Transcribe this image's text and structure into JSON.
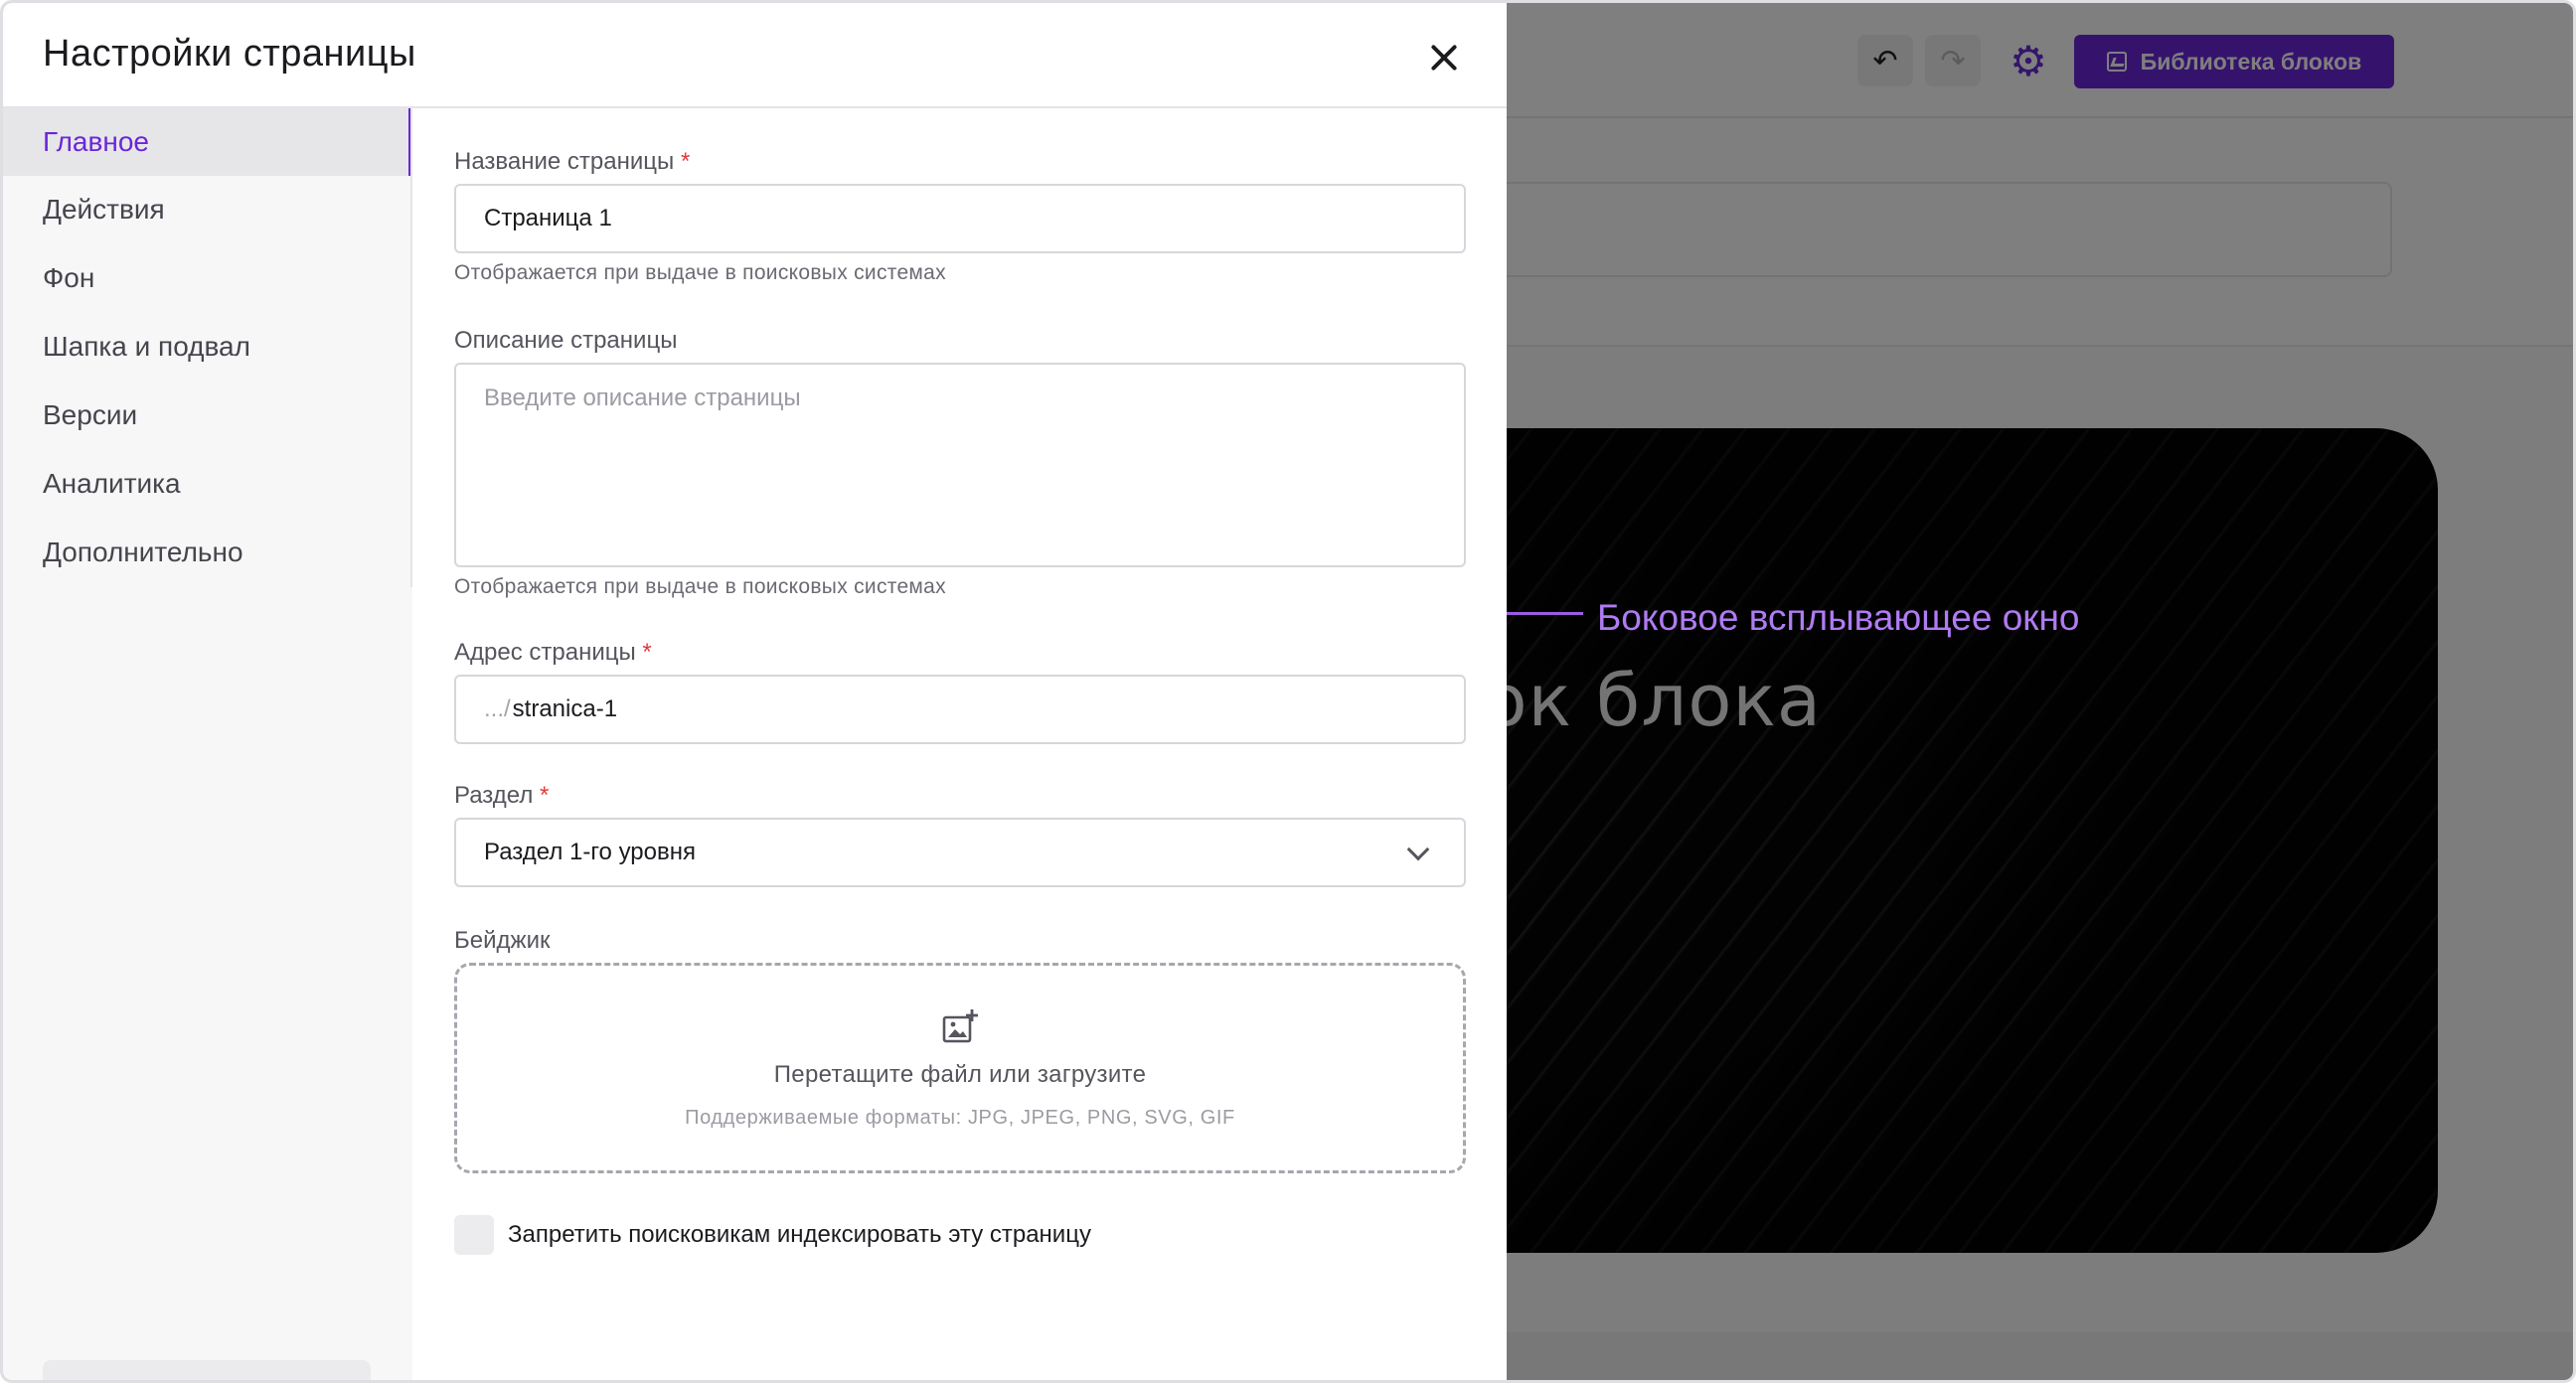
{
  "panel": {
    "title": "Настройки страницы",
    "close_icon": "close-icon"
  },
  "nav": {
    "items": [
      {
        "label": "Главное",
        "active": true
      },
      {
        "label": "Действия",
        "active": false
      },
      {
        "label": "Фон",
        "active": false
      },
      {
        "label": "Шапка и подвал",
        "active": false
      },
      {
        "label": "Версии",
        "active": false
      },
      {
        "label": "Аналитика",
        "active": false
      },
      {
        "label": "Дополнительно",
        "active": false
      }
    ]
  },
  "form": {
    "page_name": {
      "label": "Название страницы",
      "required_mark": "*",
      "value": "Страница 1",
      "hint": "Отображается при выдаче в поисковых системах"
    },
    "page_description": {
      "label": "Описание страницы",
      "placeholder": "Введите описание страницы",
      "hint": "Отображается при выдаче в поисковых системах"
    },
    "page_address": {
      "label": "Адрес страницы",
      "required_mark": "*",
      "prefix": ".../",
      "value": "stranica-1"
    },
    "section": {
      "label": "Раздел",
      "required_mark": "*",
      "selected": "Раздел 1-го уровня"
    },
    "badge": {
      "label": "Бейджик",
      "drop_title": "Перетащите файл или загрузите",
      "drop_formats": "Поддерживаемые форматы: JPG, JPEG, PNG, SVG, GIF",
      "icon": "add-image-icon"
    },
    "noindex": {
      "label": "Запретить поисковикам индексировать эту страницу",
      "checked": false
    }
  },
  "editor": {
    "library_button": "Библиотека блоков",
    "hero_title_fragment": "ок блока",
    "icons": [
      "undo-icon",
      "redo-icon",
      "gear-icon",
      "image-icon"
    ]
  },
  "annotation": {
    "text": "Боковое всплывающее окно",
    "color": "#b07bf3"
  },
  "colors": {
    "accent": "#6b26d9",
    "required": "#e03a3a"
  }
}
